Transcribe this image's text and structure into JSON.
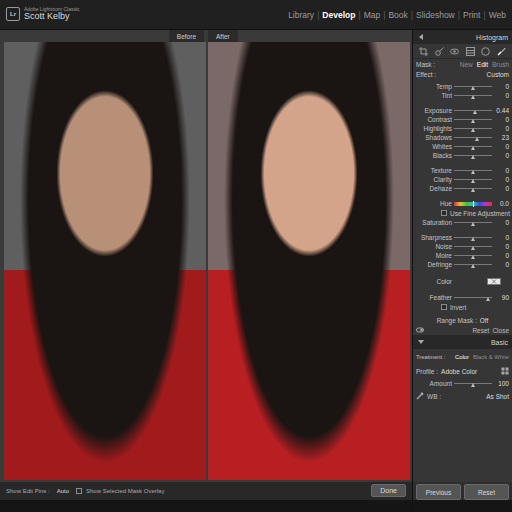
{
  "app": {
    "logo": "Lr",
    "product": "Adobe Lightroom Classic",
    "user": "Scott Kelby"
  },
  "modules": {
    "separator": "|",
    "items": [
      {
        "label": "Library",
        "selected": false
      },
      {
        "label": "Develop",
        "selected": true
      },
      {
        "label": "Map",
        "selected": false
      },
      {
        "label": "Book",
        "selected": false
      },
      {
        "label": "Slideshow",
        "selected": false
      },
      {
        "label": "Print",
        "selected": false
      },
      {
        "label": "Web",
        "selected": false
      }
    ]
  },
  "compare": {
    "labels": [
      "Before",
      "After"
    ]
  },
  "toolbar": {
    "edit_pins_label": "Show Edit Pins :",
    "edit_pins_value": "Auto",
    "overlay_label": "Show Selected Mask Overlay",
    "overlay_checked": false,
    "done": "Done"
  },
  "panel": {
    "histogram": "Histogram",
    "tools": [
      {
        "kind": "crop",
        "selected": false
      },
      {
        "kind": "spot",
        "selected": false
      },
      {
        "kind": "red-eye",
        "selected": false
      },
      {
        "kind": "graduated",
        "selected": false
      },
      {
        "kind": "radial",
        "selected": false
      },
      {
        "kind": "brush",
        "selected": true
      }
    ],
    "mask": {
      "label": "Mask :",
      "options": [
        {
          "label": "New",
          "selected": false
        },
        {
          "label": "Edit",
          "selected": true
        },
        {
          "label": "Brush",
          "selected": false
        }
      ]
    },
    "effect": {
      "label": "Effect :",
      "value": "Custom"
    },
    "groups": [
      [
        {
          "kind": "slider",
          "label": "Temp",
          "level": 0.5,
          "reading": "0"
        },
        {
          "kind": "slider",
          "label": "Tint",
          "level": 0.5,
          "reading": "0"
        }
      ],
      [
        {
          "kind": "slider",
          "label": "Exposure",
          "level": 0.555,
          "reading": "0.44"
        },
        {
          "kind": "slider",
          "label": "Contrast",
          "level": 0.5,
          "reading": "0"
        },
        {
          "kind": "slider",
          "label": "Highlights",
          "level": 0.5,
          "reading": "0"
        },
        {
          "kind": "slider",
          "label": "Shadows",
          "level": 0.615,
          "reading": "23"
        },
        {
          "kind": "slider",
          "label": "Whites",
          "level": 0.5,
          "reading": "0"
        },
        {
          "kind": "slider",
          "label": "Blacks",
          "level": 0.5,
          "reading": "0"
        }
      ],
      [
        {
          "kind": "slider",
          "label": "Texture",
          "level": 0.5,
          "reading": "0"
        },
        {
          "kind": "slider",
          "label": "Clarity",
          "level": 0.5,
          "reading": "0"
        },
        {
          "kind": "slider",
          "label": "Dehaze",
          "level": 0.5,
          "reading": "0"
        }
      ],
      [
        {
          "kind": "hue",
          "label": "Hue",
          "level": 0.5,
          "reading": "0.0"
        },
        {
          "kind": "checkbox",
          "label": "Use Fine Adjustment",
          "checked": false
        },
        {
          "kind": "slider",
          "label": "Saturation",
          "level": 0.5,
          "reading": "0"
        }
      ],
      [
        {
          "kind": "slider",
          "label": "Sharpness",
          "level": 0.5,
          "reading": "0"
        },
        {
          "kind": "slider",
          "label": "Noise",
          "level": 0.5,
          "reading": "0"
        },
        {
          "kind": "slider",
          "label": "Moire",
          "level": 0.5,
          "reading": "0"
        },
        {
          "kind": "slider",
          "label": "Defringe",
          "level": 0.5,
          "reading": "0"
        }
      ],
      [
        {
          "kind": "color",
          "label": "Color"
        }
      ],
      [
        {
          "kind": "slider",
          "label": "Feather",
          "level": 0.9,
          "reading": "90"
        },
        {
          "kind": "checkbox",
          "label": "Invert",
          "checked": false
        }
      ]
    ],
    "range_mask": {
      "label": "Range Mask :",
      "value": "Off"
    },
    "reset": "Reset",
    "close": "Close",
    "basic": {
      "title": "Basic",
      "treatment_label": "Treatment :",
      "treatments": [
        {
          "label": "Color",
          "selected": true
        },
        {
          "label": "Black & White",
          "selected": false
        }
      ],
      "profile_label": "Profile :",
      "profile": "Adobe Color",
      "amount": {
        "label": "Amount",
        "level": 0.5,
        "reading": "100"
      },
      "wb_label": "WB :",
      "wb": "As Shot"
    },
    "buttons": [
      "Previous",
      "Reset"
    ]
  }
}
